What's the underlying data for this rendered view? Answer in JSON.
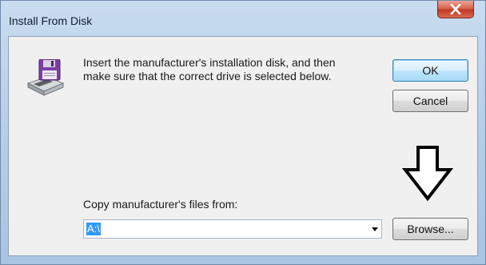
{
  "window": {
    "title": "Install From Disk"
  },
  "dialog": {
    "message": "Insert the manufacturer's installation disk, and then make sure that the correct drive is selected below.",
    "ok_label": "OK",
    "cancel_label": "Cancel",
    "copy_from_label": "Copy manufacturer's files from:",
    "copy_from_value": "A:\\",
    "browse_label": "Browse..."
  },
  "icons": {
    "disk": "floppy-disk-drive-icon",
    "close": "close-icon",
    "annotation": "arrow-down-icon",
    "dropdown": "chevron-down-icon"
  },
  "colors": {
    "selection": "#3399ff",
    "close_button": "#c13a22",
    "default_button_border": "#3c7fb1"
  }
}
